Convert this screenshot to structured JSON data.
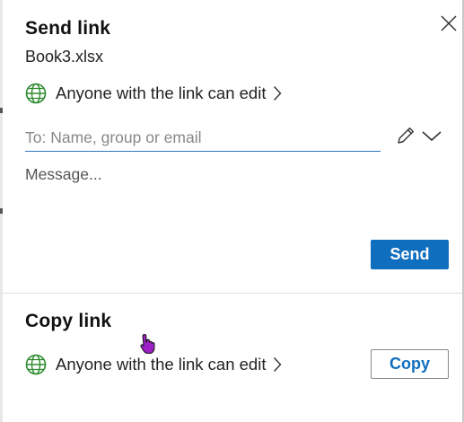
{
  "send_section": {
    "title": "Send link",
    "file_name": "Book3.xlsx",
    "permission": "Anyone with the link can edit",
    "to_placeholder": "To: Name, group or email",
    "message_placeholder": "Message...",
    "send_label": "Send"
  },
  "copy_section": {
    "title": "Copy link",
    "permission": "Anyone with the link can edit",
    "copy_label": "Copy"
  },
  "icons": {
    "close": "close-icon",
    "globe": "globe-icon",
    "chevron": "chevron-right-icon",
    "pencil": "pencil-icon",
    "dropdown": "chevron-down-icon",
    "cursor": "hand-pointer-cursor"
  },
  "colors": {
    "accent": "#106ebe",
    "globe_green": "#2e8b2e",
    "cursor_purple": "#a020c8"
  }
}
